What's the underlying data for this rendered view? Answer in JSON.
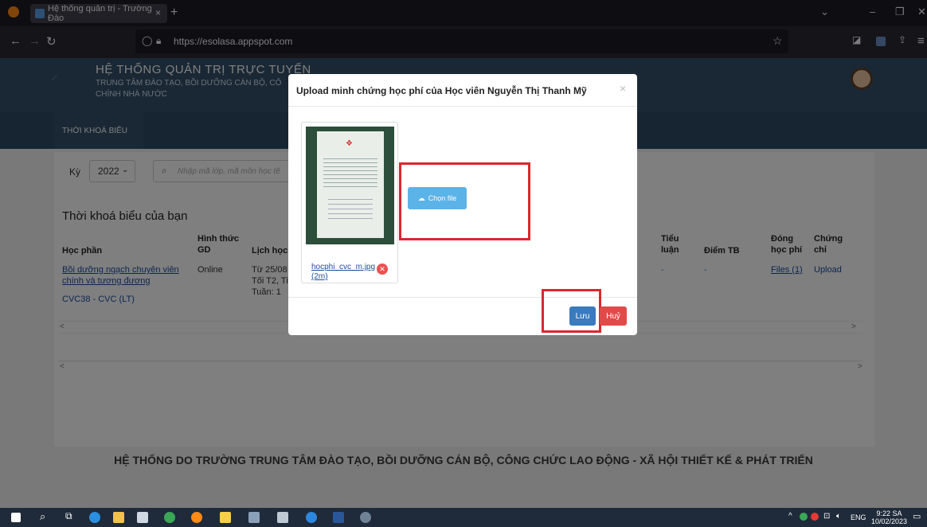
{
  "browser": {
    "tab_title": "Hệ thống quản trị - Trường Đào",
    "tab_close": "×",
    "new_tab": "+",
    "url": "https://esolasa.appspot.com"
  },
  "header": {
    "title": "HỆ THỐNG QUẢN TRỊ TRỰC TUYẾN",
    "subtitle_line1": "TRUNG TÂM ĐÀO TẠO, BỒI DƯỠNG CÁN BỘ, CÔ",
    "subtitle_line2": "CHÍNH NHÀ NƯỚC"
  },
  "menu": {
    "item1": "THỜI KHOÁ BIỂU"
  },
  "filters": {
    "ky_label": "Kỳ",
    "ky_value": "2022",
    "search_placeholder": "Nhập mã lớp, mã môn học tê"
  },
  "table": {
    "title": "Thời khoá biểu của bạn",
    "headers": {
      "hocphan": "Học phần",
      "hinhthuc_1": "Hình thức",
      "hinhthuc_2": "GD",
      "lichhoc": "Lịch học",
      "tieuluan_1": "Tiểu",
      "tieuluan_2": "luận",
      "diemtb": "Điểm TB",
      "dongphi_1": "Đóng",
      "dongphi_2": "học phí",
      "chungchi_1": "Chứng",
      "chungchi_2": "chỉ"
    },
    "row": {
      "hocphan_1": "Bồi dưỡng ngạch chuyên viên",
      "hocphan_2": "chính và tương đương",
      "code": "CVC38 - CVC (LT)",
      "hinhthuc": "Online",
      "lich_1": "Từ 25/08",
      "lich_2": "Tối T2, Tiế",
      "lich_3": "Tuần: 1",
      "tieuluan": "-",
      "diemtb": "-",
      "files": "Files (1)",
      "upload": "Upload"
    }
  },
  "footer": {
    "text": "HỆ THỐNG DO TRƯỜNG TRUNG TÂM ĐÀO TẠO, BỒI DƯỠNG CÁN BỘ, CÔNG CHỨC LAO ĐỘNG - XÃ HỘI THIẾT KẾ & PHÁT TRIỂN"
  },
  "modal": {
    "title": "Upload minh chứng học phí của Học viên Nguyễn Thị Thanh Mỹ",
    "close": "×",
    "file_name_1": "hocphi_cvc_m.jpg",
    "file_name_2": "(2m)",
    "choose_file": "Chọn file",
    "save": "Lưu",
    "cancel": "Huỷ"
  },
  "taskbar": {
    "lang": "ENG",
    "time": "9:22 SA",
    "date": "10/02/2023"
  },
  "colors": {
    "header_bg": "#35516b",
    "highlight_red": "#d9282d",
    "save_blue": "#3a7bbf",
    "cancel_red": "#e24a4a"
  }
}
